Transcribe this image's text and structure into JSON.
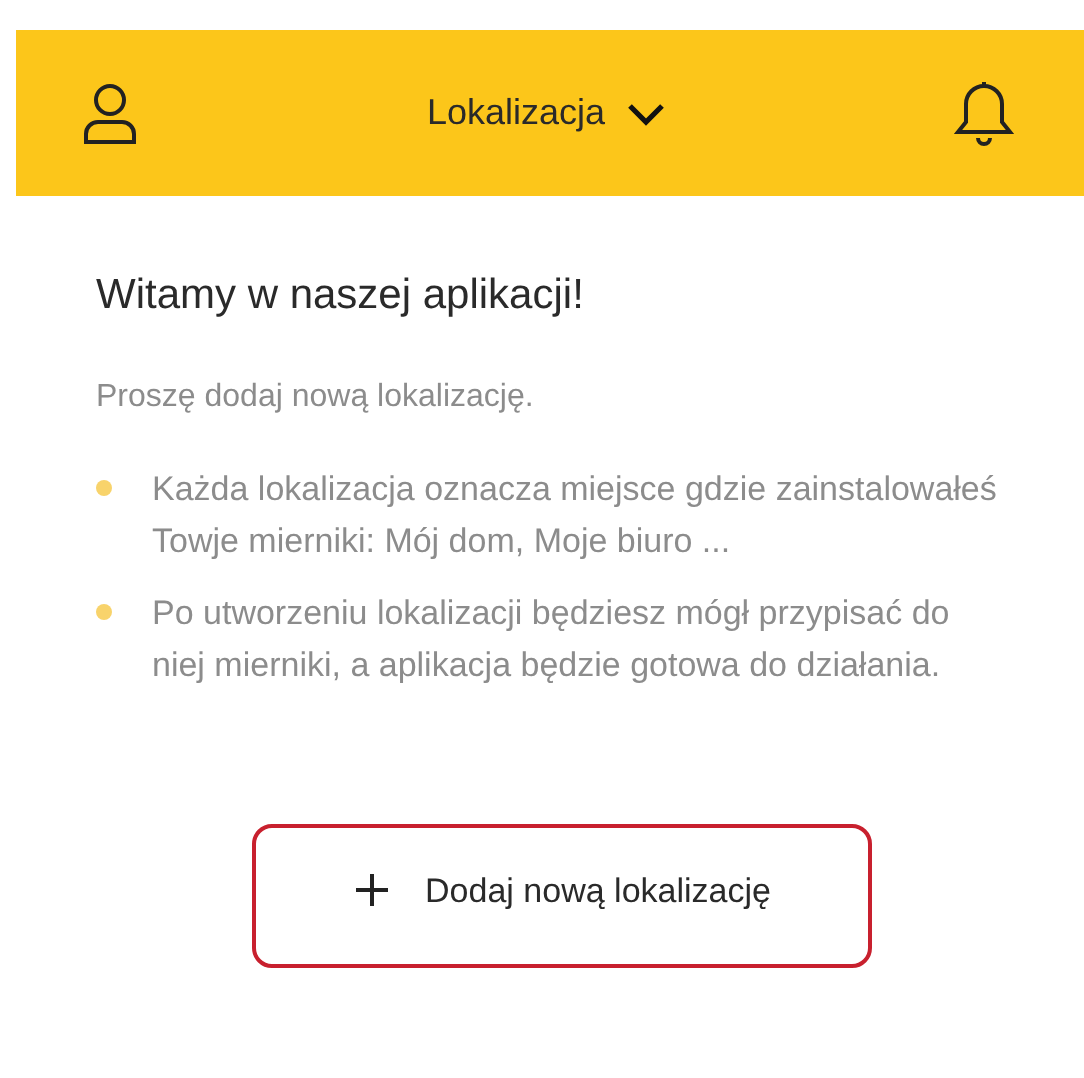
{
  "header": {
    "title": "Lokalizacja"
  },
  "heading": "Witamy w naszej aplikacji!",
  "intro": "Proszę dodaj nową lokalizację.",
  "bullets": [
    "Każda lokalizacja oznacza miejsce gdzie zainstalowałeś Towje mierniki: Mój dom, Moje biuro ...",
    "Po utworzeniu lokalizacji będziesz mógł przypisać do niej mierniki, a aplikacja będzie gotowa do działania."
  ],
  "add_button": {
    "label": "Dodaj nową lokalizację"
  }
}
